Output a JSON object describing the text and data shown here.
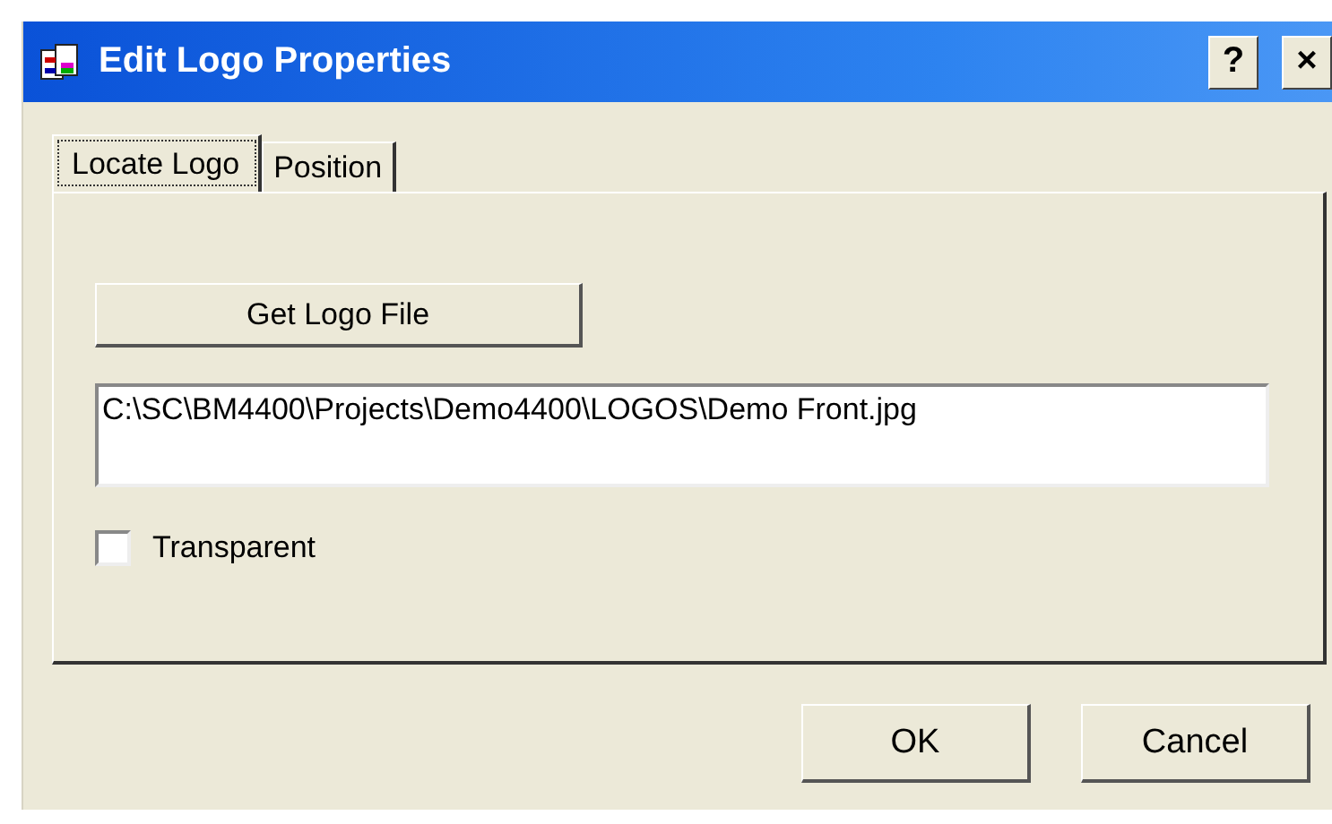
{
  "window": {
    "title": "Edit Logo Properties",
    "title_buttons": [
      "?",
      "×"
    ]
  },
  "tabs": [
    {
      "label": "Locate Logo",
      "selected": true
    },
    {
      "label": "Position",
      "selected": false
    }
  ],
  "get_logo_button": "Get Logo File",
  "file_path": {
    "value": "C:\\SC\\BM4400\\Projects\\Demo4400\\LOGOS\\Demo Front.jpg"
  },
  "transparent": {
    "label": "Transparent",
    "checked": false
  },
  "buttons": [
    "OK",
    "Cancel"
  ]
}
